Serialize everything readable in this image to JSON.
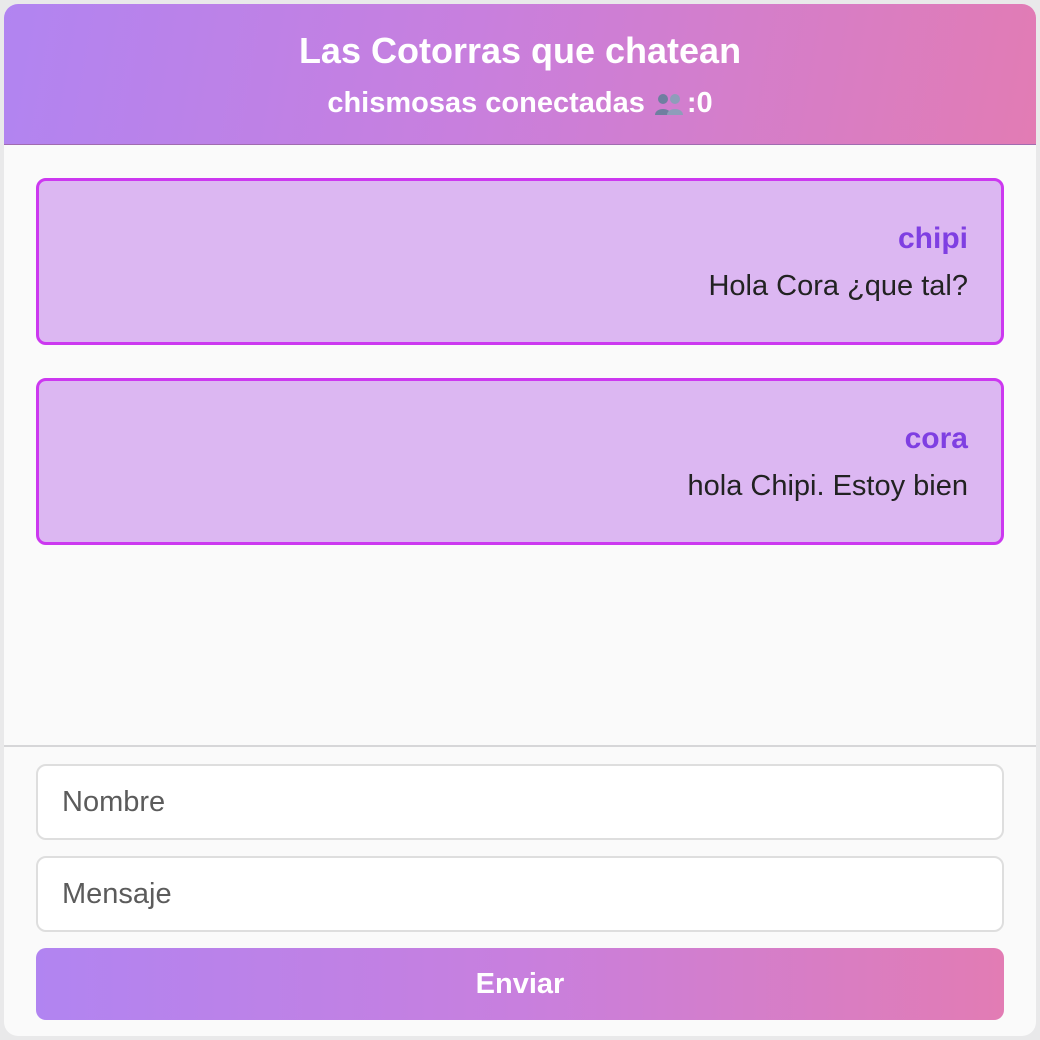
{
  "header": {
    "title": "Las Cotorras que chatean",
    "subtitle_label": "chismosas conectadas",
    "subtitle_icon": "people-icon",
    "online_count": ":0"
  },
  "messages": [
    {
      "author": "chipi",
      "text": "Hola Cora ¿que tal?"
    },
    {
      "author": "cora",
      "text": "hola Chipi. Estoy bien"
    }
  ],
  "form": {
    "name_placeholder": "Nombre",
    "name_value": "",
    "message_placeholder": "Mensaje",
    "message_value": "",
    "send_label": "Enviar"
  },
  "colors": {
    "gradient_start": "#b184f1",
    "gradient_end": "#e27cb4",
    "message_bg": "#dcb7f2",
    "message_border": "#cc38f0",
    "author": "#7f3fe2"
  }
}
